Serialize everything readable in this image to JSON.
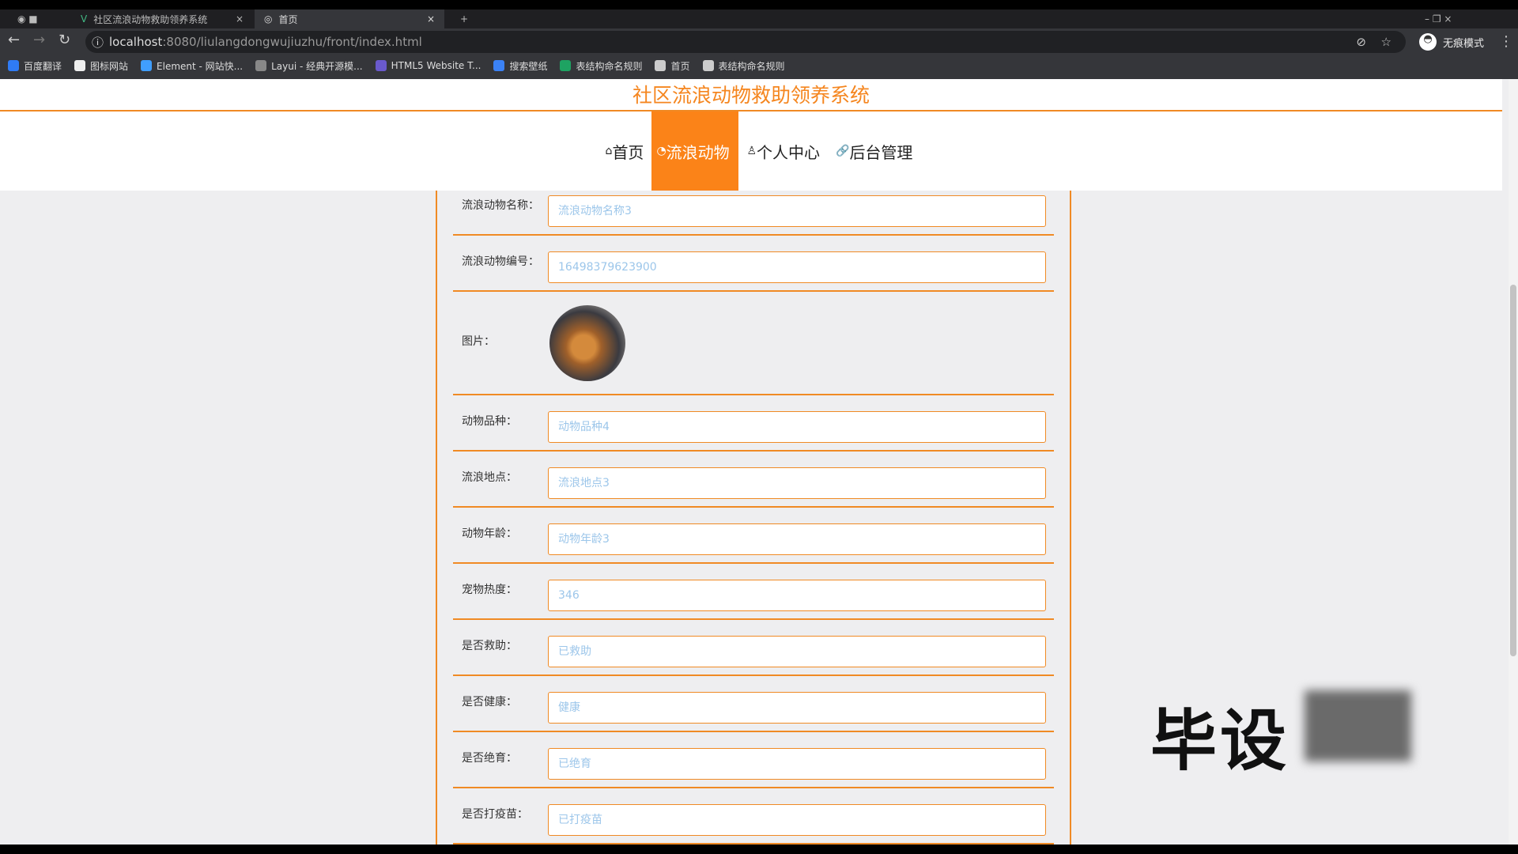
{
  "browser": {
    "tabs": [
      {
        "title": "社区流浪动物救助领养系统"
      },
      {
        "title": "首页"
      }
    ],
    "new_tab": "+",
    "url_host": "localhost",
    "url_rest": ":8080/liulangdongwujiuzhu/front/index.html",
    "incognito": "无痕模式",
    "bookmarks": [
      {
        "label": "百度翻译",
        "color": "#2f7bf5"
      },
      {
        "label": "图标网站",
        "color": "#eeeeee"
      },
      {
        "label": "Element - 网站快...",
        "color": "#409eff"
      },
      {
        "label": "Layui - 经典开源模...",
        "color": "#888888"
      },
      {
        "label": "HTML5 Website T...",
        "color": "#6a5acd"
      },
      {
        "label": "搜索壁纸",
        "color": "#3b82f6"
      },
      {
        "label": "表结构命名规则",
        "color": "#1ea362"
      },
      {
        "label": "首页",
        "color": "#cccccc"
      },
      {
        "label": "表结构命名规则",
        "color": "#cccccc"
      }
    ]
  },
  "site": {
    "title": "社区流浪动物救助领养系统",
    "accent": "#fb8318",
    "nav": [
      {
        "icon": "⌂",
        "label": "首页"
      },
      {
        "icon": "◔",
        "label": "流浪动物",
        "active": true
      },
      {
        "icon": "♙",
        "label": "个人中心"
      },
      {
        "icon": "🔗",
        "label": "后台管理"
      }
    ]
  },
  "form": {
    "fields": [
      {
        "label": "流浪动物名称：",
        "value": "流浪动物名称3"
      },
      {
        "label": "流浪动物编号：",
        "value": "16498379623900"
      },
      {
        "label": "图片：",
        "image": true
      },
      {
        "label": "动物品种：",
        "value": "动物品种4"
      },
      {
        "label": "流浪地点：",
        "value": "流浪地点3"
      },
      {
        "label": "动物年龄：",
        "value": "动物年龄3"
      },
      {
        "label": "宠物热度：",
        "value": "346"
      },
      {
        "label": "是否救助：",
        "value": "已救助"
      },
      {
        "label": "是否健康：",
        "value": "健康"
      },
      {
        "label": "是否绝育：",
        "value": "已绝育"
      },
      {
        "label": "是否打疫苗：",
        "value": "已打疫苗"
      }
    ]
  },
  "watermark": "毕设"
}
